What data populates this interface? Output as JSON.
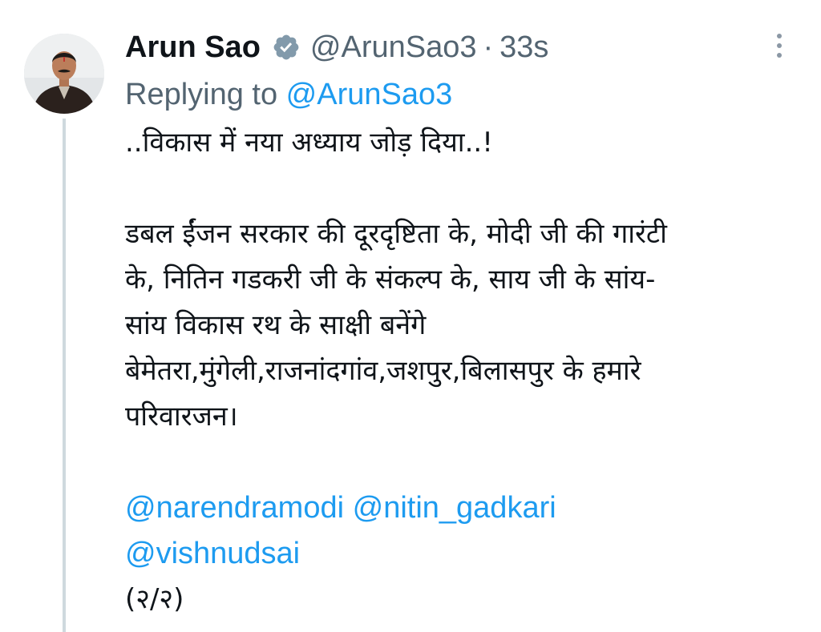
{
  "tweet": {
    "author_name": "Arun Sao",
    "handle": "@ArunSao3",
    "separator": "·",
    "time": "33s",
    "replying_prefix": "Replying to ",
    "replying_handle": "@ArunSao3",
    "lines": [
      "..विकास में नया अध्याय जोड़ दिया..!",
      "डबल ईंजन सरकार की दूरदृष्टिता के, मोदी जी की गारंटी",
      "के, नितिन गडकरी जी के संकल्प के, साय जी के सांय-",
      "सांय विकास रथ के साक्षी बनेंगे",
      "बेमेतरा,मुंगेली,राजनांदगांव,जशपुर,बिलासपुर के हमारे",
      "परिवारजन।"
    ],
    "mentions": {
      "narendramodi": "@narendramodi",
      "nitin_gadkari": "@nitin_gadkari",
      "vishnudsai": "@vishnudsai"
    },
    "thread_count": "(२/२)"
  },
  "icons": {
    "verified": "verified-badge-icon",
    "more": "more-options-icon"
  },
  "colors": {
    "mention": "#1d9bf0",
    "secondary_text": "#536471",
    "thread_line": "#cfd9de",
    "verified_badge": "#829aab"
  }
}
